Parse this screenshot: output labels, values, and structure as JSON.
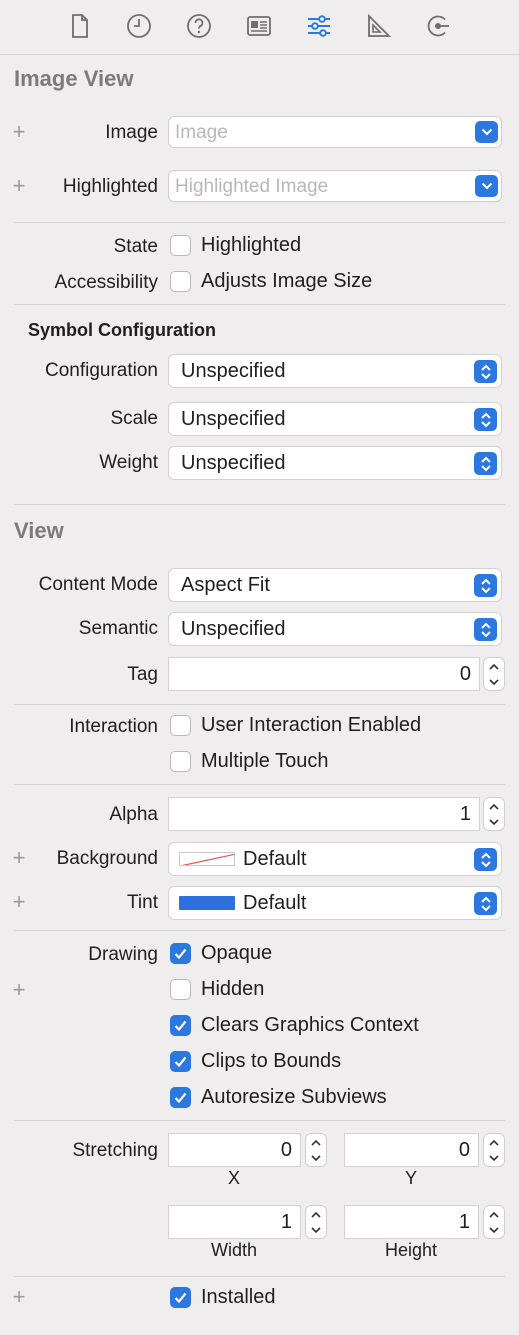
{
  "tabs": [
    {
      "icon": "file-icon",
      "active": false
    },
    {
      "icon": "history-clock-icon",
      "active": false
    },
    {
      "icon": "help-icon",
      "active": false
    },
    {
      "icon": "identity-card-icon",
      "active": false
    },
    {
      "icon": "attributes-sliders-icon",
      "active": true
    },
    {
      "icon": "size-ruler-icon",
      "active": false
    },
    {
      "icon": "connections-arrow-icon",
      "active": false
    }
  ],
  "colors": {
    "accent": "#2b79e0",
    "inactive_icon": "#6e6e6e",
    "tint_swatch": "#2f6fd9"
  },
  "image_view": {
    "title": "Image View",
    "image": {
      "label": "Image",
      "placeholder": "Image"
    },
    "highlighted": {
      "label": "Highlighted",
      "placeholder": "Highlighted Image"
    },
    "state": {
      "label": "State",
      "checkbox": "Highlighted",
      "checked": false
    },
    "accessibility": {
      "label": "Accessibility",
      "checkbox": "Adjusts Image Size",
      "checked": false
    }
  },
  "symbol_configuration": {
    "title": "Symbol Configuration",
    "configuration": {
      "label": "Configuration",
      "value": "Unspecified"
    },
    "scale": {
      "label": "Scale",
      "value": "Unspecified"
    },
    "weight": {
      "label": "Weight",
      "value": "Unspecified"
    }
  },
  "view": {
    "title": "View",
    "content_mode": {
      "label": "Content Mode",
      "value": "Aspect Fit"
    },
    "semantic": {
      "label": "Semantic",
      "value": "Unspecified"
    },
    "tag": {
      "label": "Tag",
      "value": "0"
    },
    "interaction": {
      "label": "Interaction",
      "user_interaction": {
        "text": "User Interaction Enabled",
        "checked": false
      },
      "multiple_touch": {
        "text": "Multiple Touch",
        "checked": false
      }
    },
    "alpha": {
      "label": "Alpha",
      "value": "1"
    },
    "background": {
      "label": "Background",
      "value": "Default"
    },
    "tint": {
      "label": "Tint",
      "value": "Default"
    },
    "drawing": {
      "label": "Drawing",
      "opaque": {
        "text": "Opaque",
        "checked": true
      },
      "hidden": {
        "text": "Hidden",
        "checked": false
      },
      "clears": {
        "text": "Clears Graphics Context",
        "checked": true
      },
      "clips": {
        "text": "Clips to Bounds",
        "checked": true
      },
      "autoresize": {
        "text": "Autoresize Subviews",
        "checked": true
      }
    },
    "stretching": {
      "label": "Stretching",
      "x": {
        "value": "0",
        "label": "X"
      },
      "y": {
        "value": "0",
        "label": "Y"
      },
      "width": {
        "value": "1",
        "label": "Width"
      },
      "height": {
        "value": "1",
        "label": "Height"
      }
    },
    "installed": {
      "text": "Installed",
      "checked": true
    }
  },
  "plus_symbol": "+"
}
